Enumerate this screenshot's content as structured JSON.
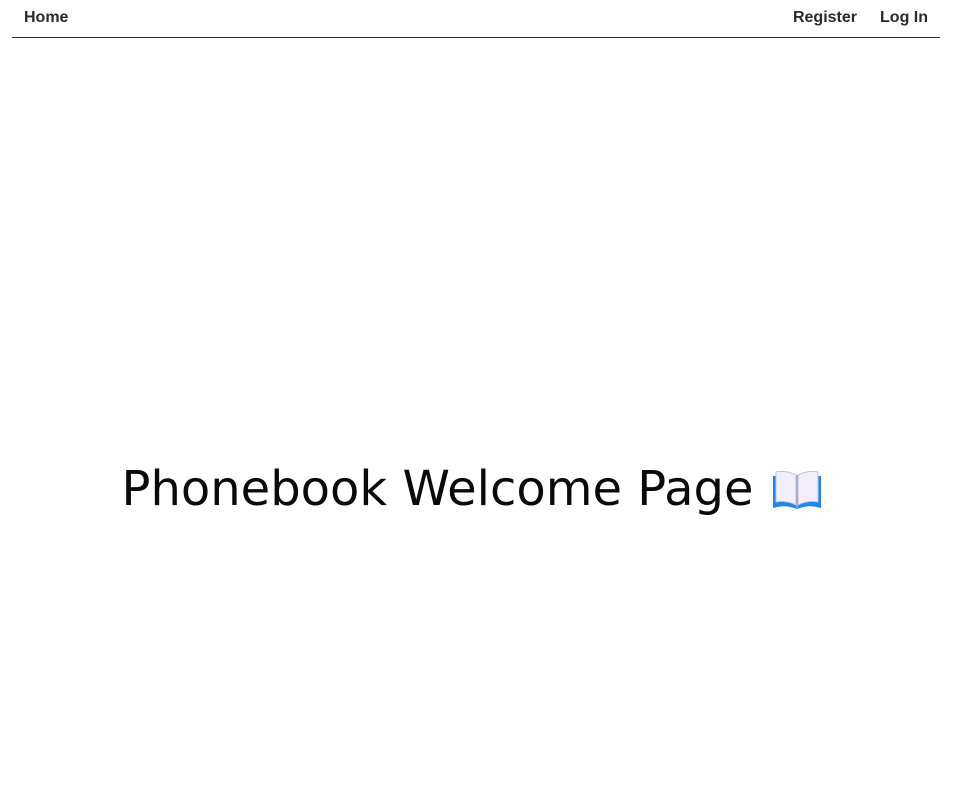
{
  "nav": {
    "home": "Home",
    "register": "Register",
    "login": "Log In"
  },
  "hero": {
    "title": "Phonebook Welcome Page",
    "icon": "open-book-icon"
  },
  "colors": {
    "text": "#0a0a0a",
    "nav_text": "#2a2a2a",
    "divider": "#2b2b2b",
    "book_cover": "#1e88e5",
    "book_pages": "#f3eefc"
  }
}
